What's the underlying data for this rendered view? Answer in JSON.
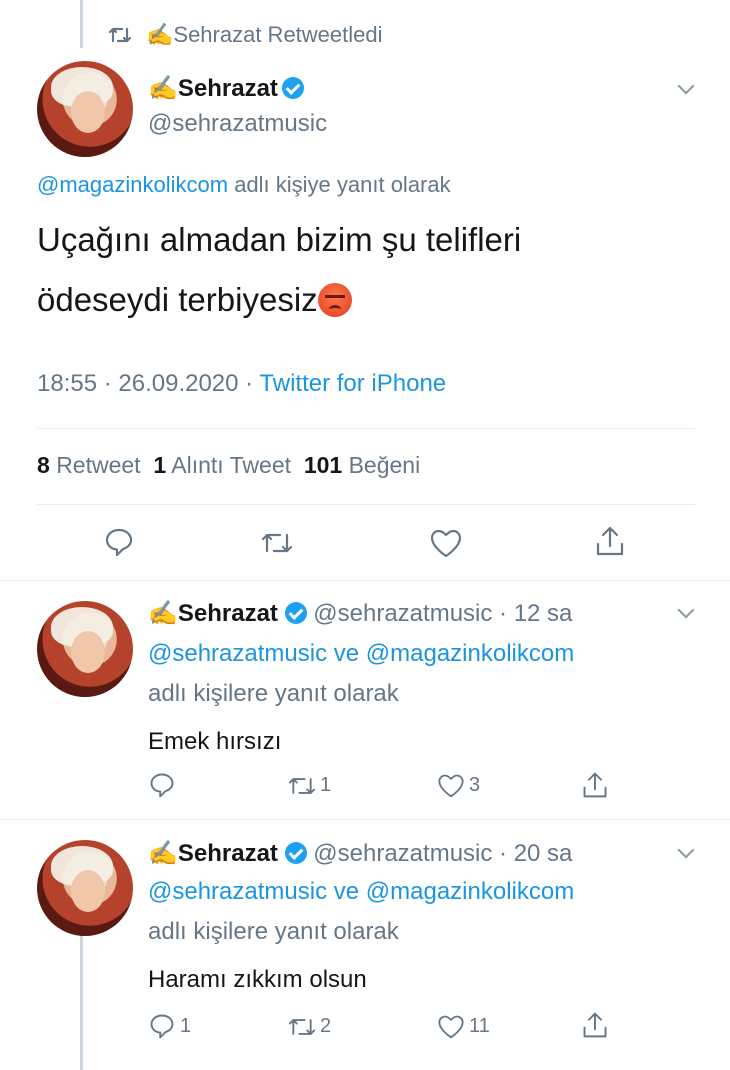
{
  "retweet_banner": {
    "text": "✍Sehrazat Retweetledi"
  },
  "main_tweet": {
    "author_name": "✍Sehrazat",
    "handle": "@sehrazatmusic",
    "reply_to_handle": "@magazinkolikcom",
    "reply_to_suffix": "adlı kişiye yanıt olarak",
    "text_line1": "Uçağını almadan bizim şu telifleri",
    "text_line2": "ödeseydi terbiyesiz",
    "emoji": "angry-face-emoji",
    "time": "18:55 · 26.09.2020 · ",
    "source": "Twitter for iPhone",
    "stats": {
      "retweets_count": "8",
      "retweets_label": "Retweet",
      "quotes_count": "1",
      "quotes_label": "Alıntı Tweet",
      "likes_count": "101",
      "likes_label": "Beğeni"
    }
  },
  "replies": [
    {
      "author_name": "✍Sehrazat",
      "handle_time": "@sehrazatmusic · 12 sa",
      "reply_handles": "@sehrazatmusic ve @magazinkolikcom",
      "reply_suffix": "adlı kişilere yanıt olarak",
      "text": "Emek hırsızı",
      "reply_count": "",
      "retweet_count": "1",
      "like_count": "3"
    },
    {
      "author_name": "✍Sehrazat",
      "handle_time": "@sehrazatmusic · 20 sa",
      "reply_handles": "@sehrazatmusic ve @magazinkolikcom",
      "reply_suffix": "adlı kişilere yanıt olarak",
      "text": "Haramı zıkkım olsun",
      "reply_count": "1",
      "retweet_count": "2",
      "like_count": "11"
    }
  ],
  "colors": {
    "link": "#1b95e0",
    "muted": "#657786",
    "verified": "#1da1f2"
  }
}
